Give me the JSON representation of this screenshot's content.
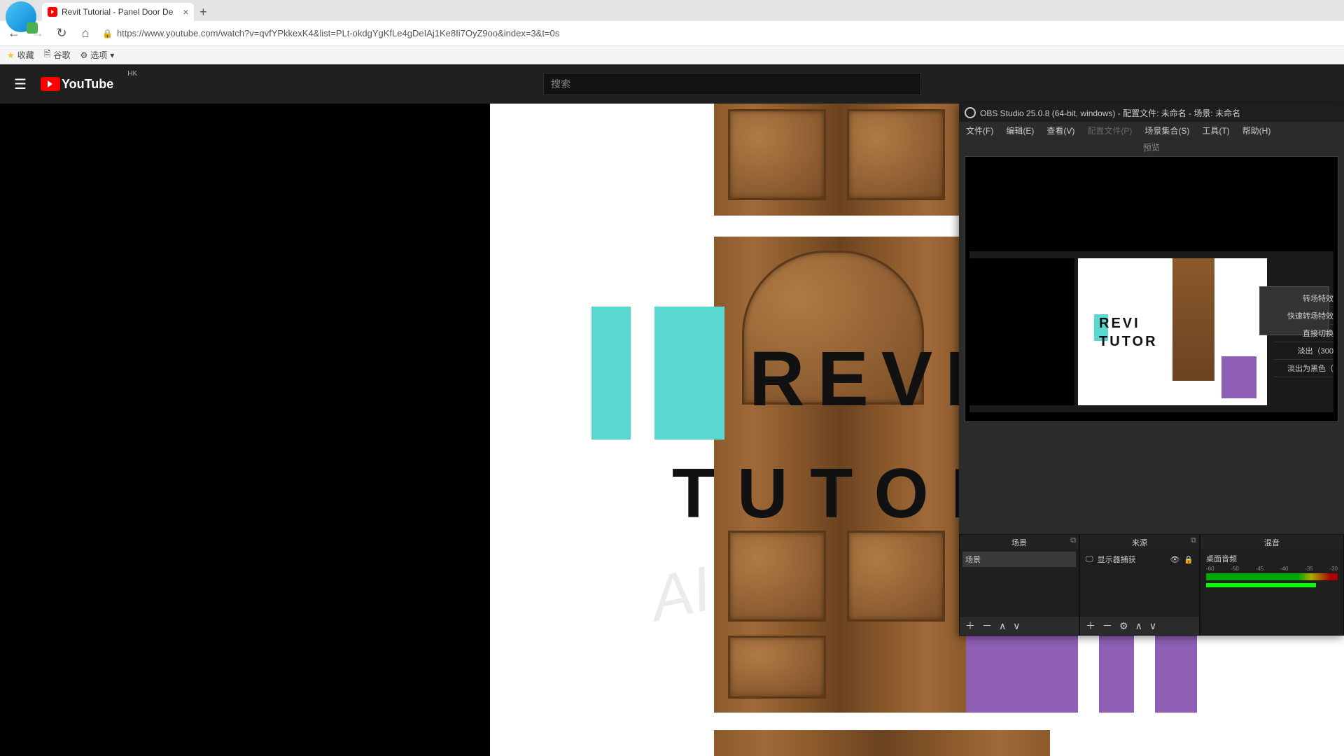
{
  "browser": {
    "tab_title": "Revit Tutorial - Panel Door De",
    "new_tab": "+",
    "close": "×",
    "url": "https://www.youtube.com/watch?v=qvfYPkkexK4&list=PLt-okdgYgKfLe4gDeIAj1Ke8Ii7OyZ9oo&index=3&t=0s",
    "bookmarks": {
      "fav": "收藏",
      "google": "谷歌",
      "options": "选项"
    }
  },
  "youtube": {
    "brand": "YouTube",
    "region": "HK",
    "search_placeholder": "搜索"
  },
  "video": {
    "line1": "REVIT",
    "line2": "TUTOR",
    "watermark": "AI"
  },
  "obs": {
    "title": "OBS Studio 25.0.8 (64-bit, windows) - 配置文件: 未命名 - 场景: 未命名",
    "menu": {
      "file": "文件(F)",
      "edit": "编辑(E)",
      "view": "查看(V)",
      "profile": "配置文件(P)",
      "scene_col": "场景集合(S)",
      "tools": "工具(T)",
      "help": "帮助(H)"
    },
    "preview_label": "预览",
    "transitions": {
      "t1": "转场特效",
      "t2": "快速转场特效",
      "t3": "直接切换",
      "t4": "淡出（300",
      "t5": "淡出为黑色（"
    },
    "docks": {
      "scenes_title": "场景",
      "scenes_item": "场景",
      "sources_title": "来源",
      "sources_item": "显示器捕获",
      "mixer_title": "混音",
      "mixer_item": "桌面音频",
      "mixer_ticks": [
        "-60",
        "-50",
        "-45",
        "-40",
        "-35",
        "-30"
      ]
    },
    "mini": {
      "l1": "REVI",
      "l2": "TUTOR"
    }
  }
}
